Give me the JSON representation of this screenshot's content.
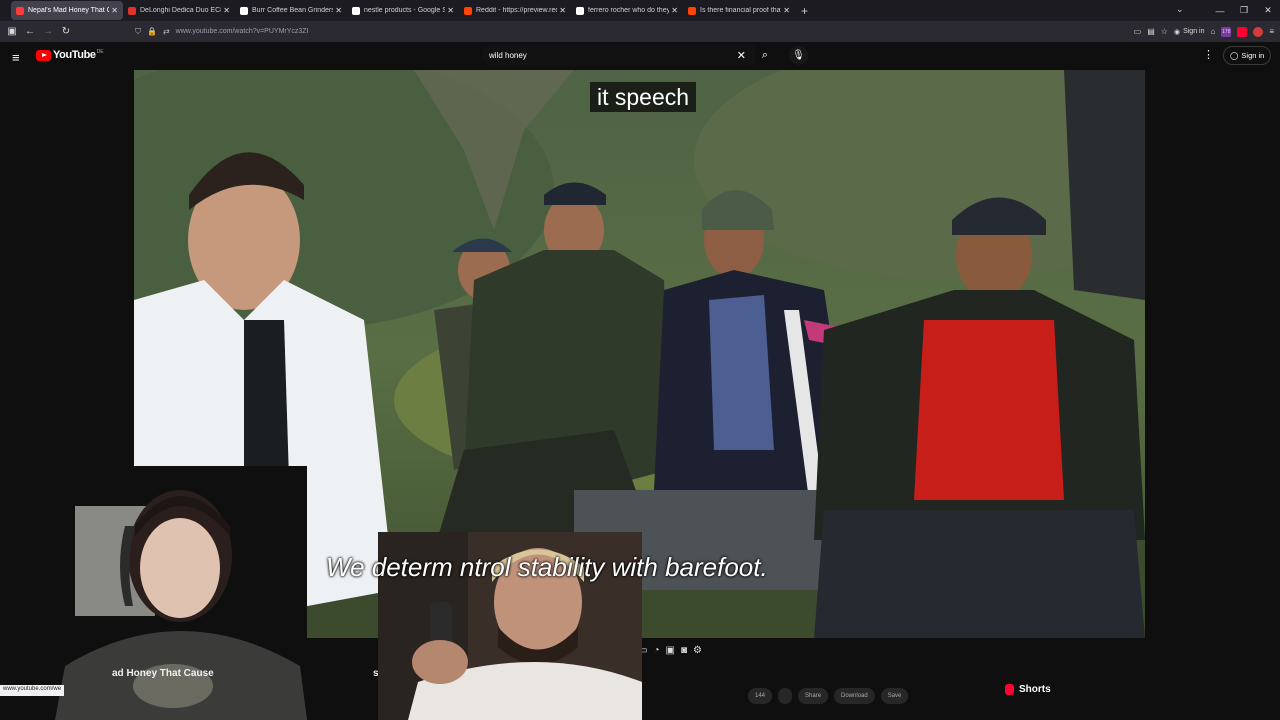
{
  "browser": {
    "tabs": [
      {
        "title": "Nepal's Mad Honey That C",
        "color": "#ff3b3b",
        "active": true
      },
      {
        "title": "DeLonghi Dedica Duo EC890.GY",
        "color": "#d9352b",
        "active": false
      },
      {
        "title": "Burr Coffee Bean Grinders | Bre",
        "color": "#ffffff",
        "active": false
      },
      {
        "title": "nestle products - Google Search",
        "color": "#ffffff",
        "active": false
      },
      {
        "title": "Reddit - https://preview.redd.it",
        "color": "#ff4500",
        "active": false
      },
      {
        "title": "ferrero rocher who do they own",
        "color": "#ffffff",
        "active": false
      },
      {
        "title": "Is there financial proof that the",
        "color": "#ff4500",
        "active": false
      }
    ],
    "url": "www.youtube.com/watch?v=PUYMrYcz3ZI",
    "sign_in": "Sign in",
    "extension_badge": "178"
  },
  "youtube": {
    "logo_text": "YouTube",
    "country_code": "DE",
    "search_value": "wild honey",
    "sign_in": "Sign in"
  },
  "video": {
    "caption_top": "it speech",
    "caption_bottom": "We determ          ntrol stability with barefoot."
  },
  "below_video": {
    "title_fragment": "ad Honey That Cause",
    "title_fragment_2": "san",
    "shorts_label": "Shorts",
    "action_pills": [
      "144",
      "",
      "Share",
      "Download",
      "Save"
    ],
    "status_url": "www.youtube.com/we"
  },
  "colors": {
    "yt_red": "#ff0000",
    "bg": "#0f0f0f",
    "link_blue": "#3ea6ff"
  }
}
